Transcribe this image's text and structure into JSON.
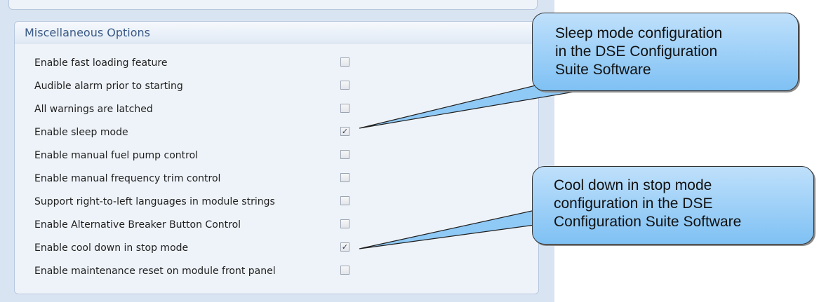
{
  "panel": {
    "title": "Miscellaneous Options"
  },
  "options": [
    {
      "label": "Enable fast loading feature",
      "checked": false
    },
    {
      "label": "Audible alarm prior to starting",
      "checked": false
    },
    {
      "label": "All warnings are latched",
      "checked": false
    },
    {
      "label": "Enable sleep mode",
      "checked": true
    },
    {
      "label": "Enable manual fuel pump control",
      "checked": false
    },
    {
      "label": "Enable manual frequency trim control",
      "checked": false
    },
    {
      "label": "Support right-to-left languages in module strings",
      "checked": false
    },
    {
      "label": "Enable Alternative Breaker Button Control",
      "checked": false
    },
    {
      "label": "Enable cool down in stop mode",
      "checked": true
    },
    {
      "label": "Enable maintenance reset on module front panel",
      "checked": false
    }
  ],
  "callouts": [
    {
      "lines": [
        "Sleep mode configuration",
        "in the DSE Configuration",
        "Suite Software"
      ]
    },
    {
      "lines": [
        "Cool down in stop mode",
        "configuration in the DSE",
        "Configuration Suite Software"
      ]
    }
  ]
}
